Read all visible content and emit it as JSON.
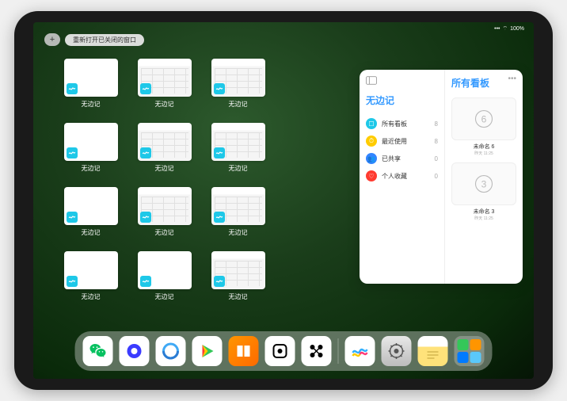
{
  "status": {
    "signal": "•••",
    "wifi": "⌔",
    "battery_pct": "100%"
  },
  "toolbar": {
    "plus": "+",
    "reopen_label": "重新打开已关闭的窗口"
  },
  "app_name": "无边记",
  "thumbs": [
    {
      "label": "无边记",
      "variant": "blank"
    },
    {
      "label": "无边记",
      "variant": "content"
    },
    {
      "label": "无边记",
      "variant": "content"
    },
    {
      "label": "无边记",
      "variant": "blank"
    },
    {
      "label": "无边记",
      "variant": "content"
    },
    {
      "label": "无边记",
      "variant": "content"
    },
    {
      "label": "无边记",
      "variant": "blank"
    },
    {
      "label": "无边记",
      "variant": "content"
    },
    {
      "label": "无边记",
      "variant": "content"
    },
    {
      "label": "无边记",
      "variant": "blank"
    },
    {
      "label": "无边记",
      "variant": "blank"
    },
    {
      "label": "无边记",
      "variant": "content"
    }
  ],
  "panel": {
    "left_title": "无边记",
    "right_title": "所有看板",
    "items": [
      {
        "icon_bg": "#1ec8e8",
        "glyph": "☐",
        "label": "所有看板",
        "count": "8"
      },
      {
        "icon_bg": "#ffcc00",
        "glyph": "⏱",
        "label": "最近使用",
        "count": "8"
      },
      {
        "icon_bg": "#3385ff",
        "glyph": "👥",
        "label": "已共享",
        "count": "0"
      },
      {
        "icon_bg": "#ff3b30",
        "glyph": "♡",
        "label": "个人收藏",
        "count": "0"
      }
    ],
    "boards": [
      {
        "name": "未命名 6",
        "sub": "昨天 11:25",
        "digit": "6"
      },
      {
        "name": "未命名 3",
        "sub": "昨天 11:25",
        "digit": "3"
      }
    ]
  },
  "dock": {
    "icons": [
      {
        "name": "wechat",
        "bg": "#ffffff"
      },
      {
        "name": "quark",
        "bg": "#ffffff"
      },
      {
        "name": "qqbrowser",
        "bg": "#ffffff"
      },
      {
        "name": "media",
        "bg": "#ffffff"
      },
      {
        "name": "books",
        "bg": "linear-gradient(135deg,#ff9500,#ff6a00)"
      },
      {
        "name": "dice",
        "bg": "#ffffff"
      },
      {
        "name": "connect",
        "bg": "#ffffff"
      },
      {
        "name": "freeform",
        "bg": "#ffffff"
      },
      {
        "name": "settings",
        "bg": "linear-gradient(#dedede,#bcbcbc)"
      },
      {
        "name": "notes",
        "bg": "linear-gradient(#fff 35%,#ffe27a 35%)"
      }
    ]
  }
}
